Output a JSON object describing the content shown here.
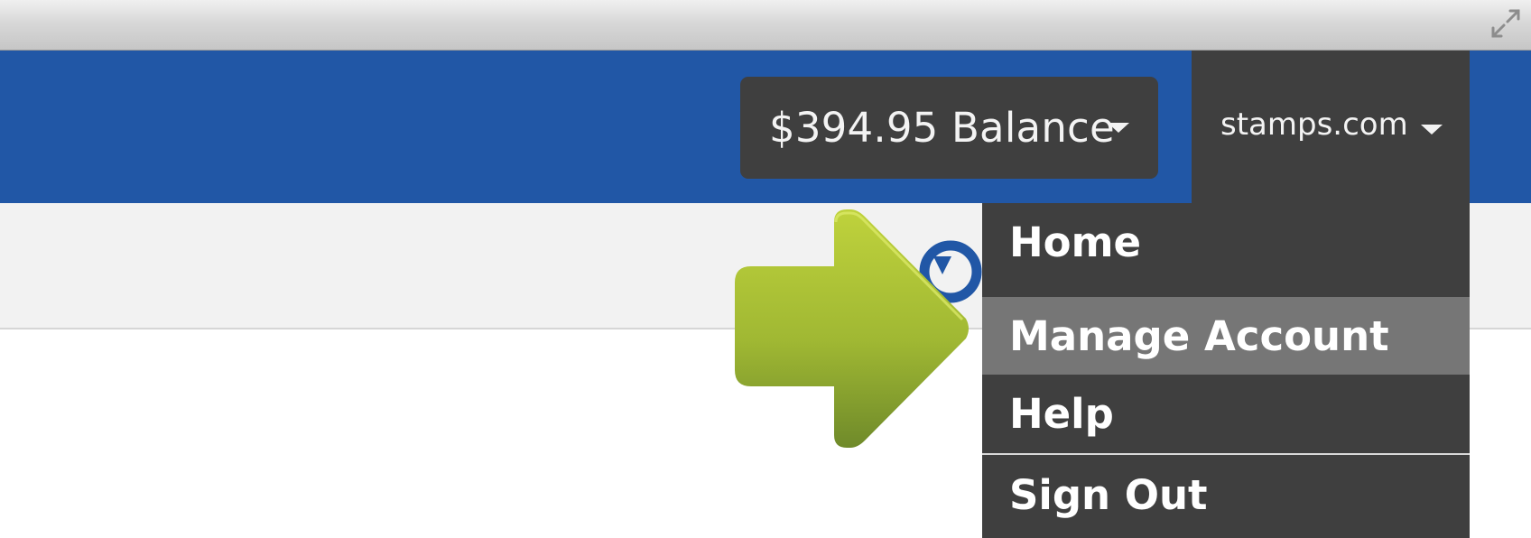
{
  "window": {
    "expand_icon": "expand-arrows-icon"
  },
  "header": {
    "balance_label": "$394.95 Balance",
    "account_name": "stamps.com",
    "caret_icon": "caret-down-icon"
  },
  "toolbar": {
    "refresh_icon": "refresh-icon"
  },
  "account_menu": {
    "items": [
      {
        "label": "Home"
      },
      {
        "label": "Manage Account",
        "highlighted": true
      },
      {
        "label": "Help"
      },
      {
        "label": "Sign Out"
      }
    ]
  },
  "annotation": {
    "arrow_icon": "green-arrow-icon"
  },
  "colors": {
    "header_blue": "#2157a6",
    "dark_panel": "#3f3f3f",
    "highlight_gray": "#767676",
    "arrow_green": "#a4bc32"
  }
}
